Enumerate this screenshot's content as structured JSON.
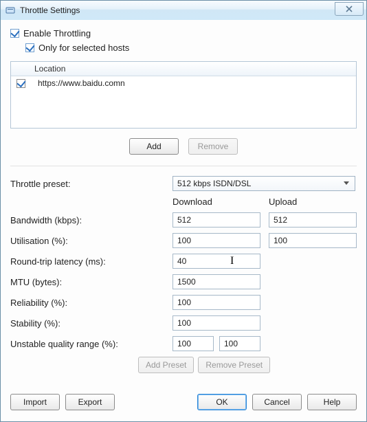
{
  "title": "Throttle Settings",
  "checkboxes": {
    "enable_label": "Enable Throttling",
    "only_hosts_label": "Only for selected hosts"
  },
  "list": {
    "header": "Location",
    "rows": [
      {
        "checked": true,
        "location": "https://www.baidu.comn"
      }
    ]
  },
  "buttons": {
    "add": "Add",
    "remove": "Remove",
    "add_preset": "Add Preset",
    "remove_preset": "Remove Preset",
    "import": "Import",
    "export": "Export",
    "ok": "OK",
    "cancel": "Cancel",
    "help": "Help"
  },
  "preset": {
    "label": "Throttle preset:",
    "value": "512 kbps ISDN/DSL"
  },
  "columns": {
    "download": "Download",
    "upload": "Upload"
  },
  "fields": {
    "bandwidth": {
      "label": "Bandwidth (kbps):",
      "download": "512",
      "upload": "512"
    },
    "utilisation": {
      "label": "Utilisation (%):",
      "download": "100",
      "upload": "100"
    },
    "latency": {
      "label": "Round-trip latency (ms):",
      "value": "40"
    },
    "mtu": {
      "label": "MTU (bytes):",
      "value": "1500"
    },
    "reliability": {
      "label": "Reliability (%):",
      "value": "100"
    },
    "stability": {
      "label": "Stability (%):",
      "value": "100"
    },
    "unstable_range": {
      "label": "Unstable quality range (%):",
      "from": "100",
      "to": "100"
    }
  }
}
